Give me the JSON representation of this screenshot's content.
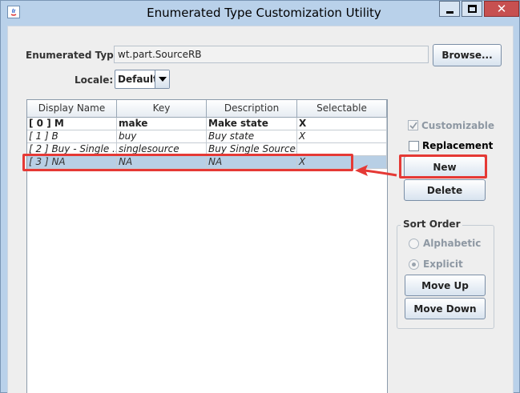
{
  "window": {
    "title": "Enumerated Type Customization Utility",
    "close_glyph": "✕"
  },
  "form": {
    "enum_type_label": "Enumerated Type:",
    "enum_type_value": "wt.part.SourceRB",
    "browse_label": "Browse...",
    "locale_label": "Locale:",
    "locale_value": "Default"
  },
  "table": {
    "columns": [
      "Display Name",
      "Key",
      "Description",
      "Selectable"
    ],
    "rows": [
      {
        "display": "[ 0 ]  M",
        "key": "make",
        "description": "Make state",
        "selectable": "X",
        "style": "bold"
      },
      {
        "display": "[ 1 ]  B",
        "key": "buy",
        "description": "Buy state",
        "selectable": "X",
        "style": "italic"
      },
      {
        "display": "[ 2 ]  Buy - Single ...",
        "key": "singlesource",
        "description": "Buy Single Source...",
        "selectable": "",
        "style": "italic"
      },
      {
        "display": "[ 3 ]  NA",
        "key": "NA",
        "description": "NA",
        "selectable": "X",
        "style": "italic selected"
      }
    ]
  },
  "options": {
    "customizable_label": "Customizable",
    "replacement_label": "Replacement",
    "new_label": "New",
    "delete_label": "Delete"
  },
  "sort_order": {
    "title": "Sort Order",
    "alphabetic_label": "Alphabetic",
    "explicit_label": "Explicit",
    "move_up_label": "Move Up",
    "move_down_label": "Move Down"
  },
  "colors": {
    "annotation": "#e53935",
    "selection": "#b8cfe5"
  }
}
